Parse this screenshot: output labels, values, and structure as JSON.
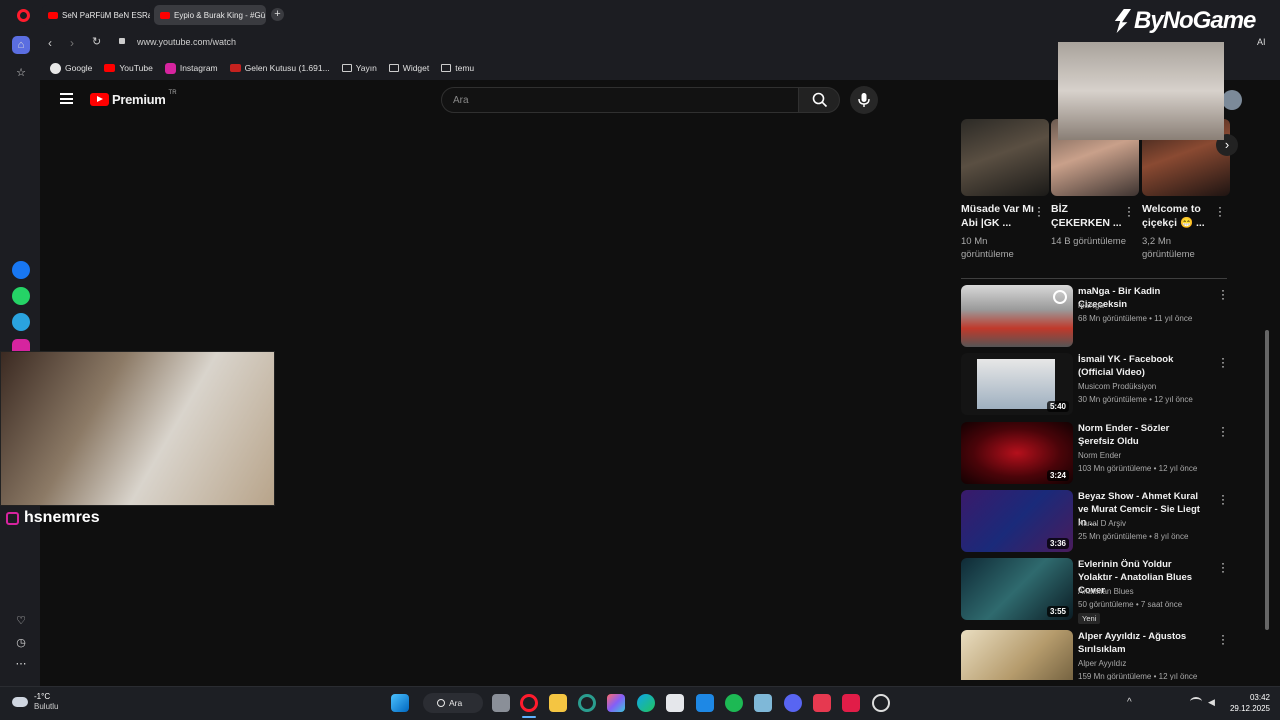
{
  "tabs": [
    {
      "label": "SeN PaRFüM BeN ESRaR",
      "active": false
    },
    {
      "label": "Eypio & Burak King - #Gü",
      "active": true
    }
  ],
  "address": {
    "url": "www.youtube.com/watch"
  },
  "bookmarks": [
    "Google",
    "YouTube",
    "Instagram",
    "Gelen Kutusu (1.691...",
    "Yayın",
    "Widget",
    "temu"
  ],
  "overlay": {
    "brand": "ByNoGame",
    "ai_label": "AI",
    "streamer_name": "hsnemres"
  },
  "youtube": {
    "logo_text": "Premium",
    "logo_region": "TR",
    "search_placeholder": "Ara",
    "shorts": [
      {
        "title": "Müsade Var Mı Abi |GK ...",
        "views": "10 Mn görüntüleme"
      },
      {
        "title": "BİZ ÇEKERKEN ...",
        "views": "14 B görüntüleme"
      },
      {
        "title": "Welcome to çiçekçi 😁 ...",
        "views": "3,2 Mn görüntüleme"
      }
    ],
    "videos": [
      {
        "title": "maNga - Bir Kadin Çizeceksin",
        "channel": "maNga",
        "meta": "68 Mn görüntüleme • 11 yıl önce",
        "duration": ""
      },
      {
        "title": "İsmail YK - Facebook (Official Video)",
        "channel": "Musicom Prodüksiyon",
        "meta": "30 Mn görüntüleme • 12 yıl önce",
        "duration": "5:40"
      },
      {
        "title": "Norm Ender - Sözler Şerefsiz Oldu",
        "channel": "Norm Ender",
        "meta": "103 Mn görüntüleme • 12 yıl önce",
        "duration": "3:24"
      },
      {
        "title": "Beyaz Show - Ahmet Kural ve Murat Cemcir - Sie Liegt In ...",
        "channel": "Kanal D Arşiv",
        "meta": "25 Mn görüntüleme • 8 yıl önce",
        "duration": "3:36"
      },
      {
        "title": "Evlerinin Önü Yoldur Yolaktır - Anatolian Blues Cover",
        "channel": "Anatolian Blues",
        "meta": "50 görüntüleme • 7 saat önce",
        "duration": "3:55",
        "badge": "Yeni"
      },
      {
        "title": "Alper Ayyıldız - Ağustos Sırılsıklam",
        "channel": "Alper Ayyıldız",
        "meta": "159 Mn görüntüleme • 12 yıl önce",
        "duration": ""
      }
    ]
  },
  "taskbar": {
    "weather_temp": "-1°C",
    "weather_desc": "Bulutlu",
    "search_label": "Ara",
    "time": "03:42",
    "date": "29.12.2025"
  },
  "colors": {
    "accent_red": "#ff0000",
    "opera_red": "#ff1b2d",
    "bg": "#0f0f0f"
  }
}
